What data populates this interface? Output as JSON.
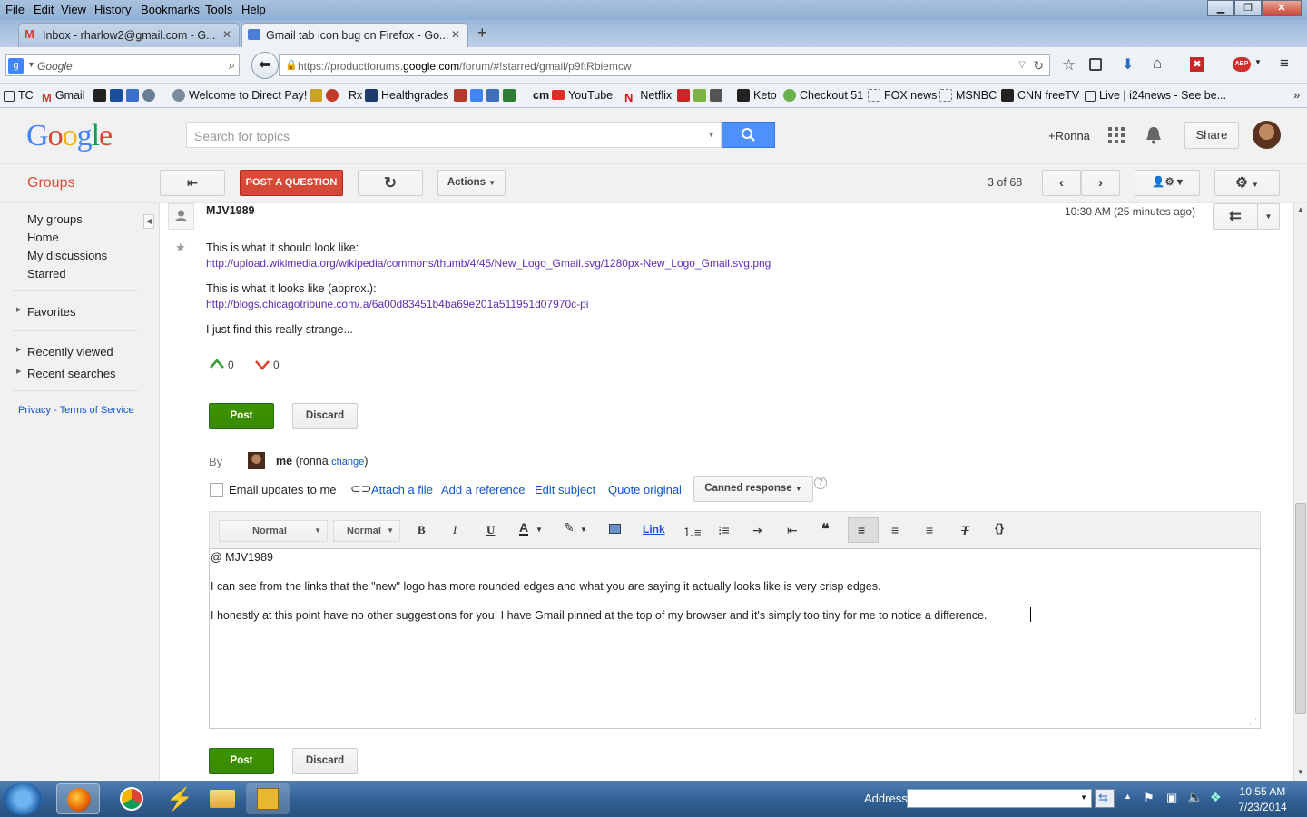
{
  "browser": {
    "menu": [
      "File",
      "Edit",
      "View",
      "History",
      "Bookmarks",
      "Tools",
      "Help"
    ],
    "tabs": [
      {
        "label": "Inbox - rharlow2@gmail.com - G..."
      },
      {
        "label": "Gmail tab icon bug on Firefox - Go..."
      }
    ],
    "new_tab": "+",
    "search_engine_placeholder": "Google",
    "url_prefix": "https://productforums.",
    "url_domain": "google.com",
    "url_path": "/forum/#!starred/gmail/p9ftRbiemcw",
    "bookmarks": [
      "TC",
      "Gmail",
      "Welcome to Direct Pay!",
      "Rx",
      "Healthgrades",
      "cm",
      "YouTube",
      "Netflix",
      "Keto",
      "Checkout 51",
      "FOX news",
      "MSNBC",
      "CNN freeTV",
      "Live | i24news - See be..."
    ]
  },
  "google_header": {
    "logo": "Google",
    "search_placeholder": "Search for topics",
    "user": "+Ronna",
    "share": "Share"
  },
  "groups_bar": {
    "title": "Groups",
    "post_question": "POST A QUESTION",
    "actions": "Actions",
    "pager": "3 of 68"
  },
  "sidebar": {
    "items": [
      "My groups",
      "Home",
      "My discussions",
      "Starred"
    ],
    "favorites": "Favorites",
    "recently_viewed": "Recently viewed",
    "recent_searches": "Recent searches",
    "footer": "Privacy - Terms of Service"
  },
  "post": {
    "author": "MJV1989",
    "time": "10:30 AM (25 minutes ago)",
    "line1": "This is what it should look like:",
    "link1": "http://upload.wikimedia.org/wikipedia/commons/thumb/4/45/New_Logo_Gmail.svg/1280px-New_Logo_Gmail.svg.png",
    "line2": "This is what it looks like (approx.):",
    "link2": "http://blogs.chicagotribune.com/.a/6a00d83451b4ba69e201a511951d07970c-pi",
    "line3": "I just find this really strange...",
    "upvotes": "0",
    "downvotes": "0"
  },
  "reply": {
    "post": "Post",
    "discard": "Discard",
    "by": "By",
    "me": "me",
    "name_prefix": "(ronna ",
    "change": "change",
    "name_suffix": ")",
    "email_updates": "Email updates to me",
    "attach": "Attach a file",
    "add_reference": "Add a reference",
    "edit_subject": "Edit subject",
    "quote_original": "Quote original",
    "canned": "Canned response",
    "help": "?"
  },
  "toolbar": {
    "font": "Normal",
    "size": "Normal",
    "bold": "B",
    "italic": "I",
    "underline": "U",
    "text_color": "A",
    "link": "Link",
    "code": "{}"
  },
  "editor": {
    "line1": "@ MJV1989",
    "line2": "I can see from the links that the \"new\" logo has more rounded edges and what you are saying it actually looks like is very crisp edges.",
    "line3": "I honestly at this point have no other suggestions for you!  I have Gmail pinned at the top of my browser and it's simply too tiny for me to notice a difference."
  },
  "taskbar": {
    "address_label": "Address",
    "time": "10:55 AM",
    "date": "7/23/2014"
  },
  "colors": {
    "accent_red": "#dd4b39",
    "google_blue": "#4d90fe",
    "post_green": "#3d9400",
    "link_purple": "#5a2fb3"
  }
}
